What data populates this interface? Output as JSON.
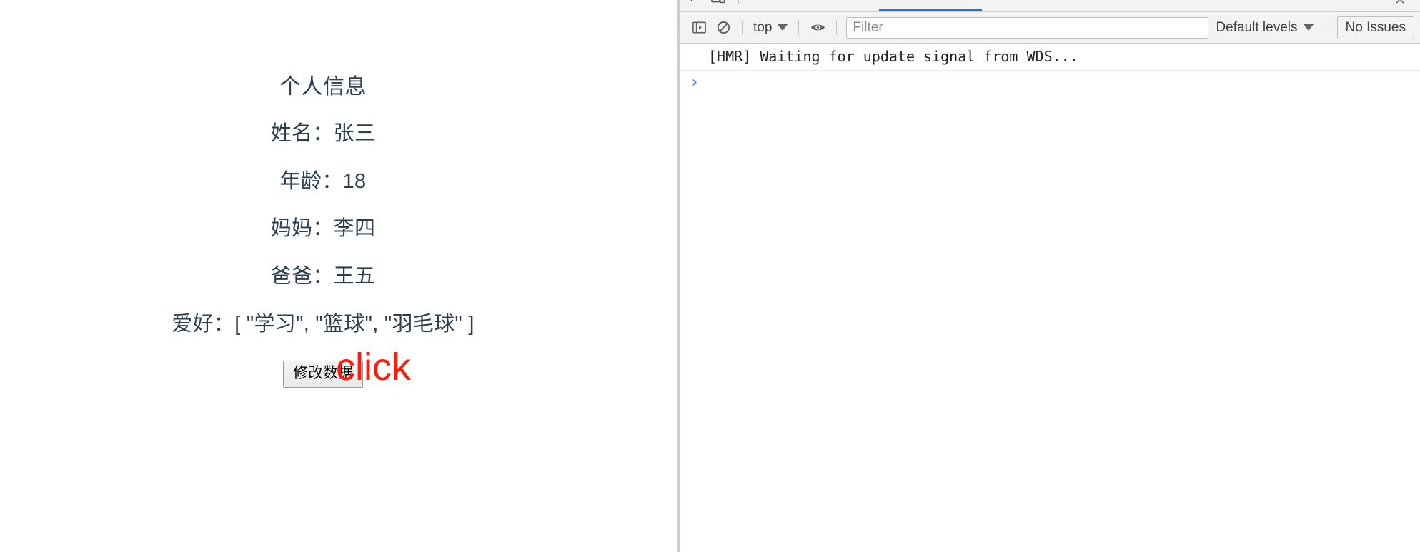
{
  "page": {
    "title": "个人信息",
    "fields": [
      {
        "label": "姓名：",
        "value": "张三"
      },
      {
        "label": "年龄：",
        "value": "18"
      },
      {
        "label": "妈妈：",
        "value": "李四"
      },
      {
        "label": "爸爸：",
        "value": "王五"
      },
      {
        "label": "爱好：",
        "value": "[ \"学习\", \"篮球\", \"羽毛球\" ]"
      }
    ],
    "button_label": "修改数据",
    "annotation": "click",
    "annotation_color": "#ff1a09",
    "text_color": "#2c3e50"
  },
  "devtools": {
    "main_toolbar": {
      "inspect_icon": "inspect-element-icon",
      "device_icon": "device-toolbar-icon",
      "close_icon": "close-icon"
    },
    "console_toolbar": {
      "sidebar_toggle_icon": "console-sidebar-toggle-icon",
      "clear_icon": "clear-console-icon",
      "context_label": "top",
      "context_caret_icon": "chevron-down-icon",
      "eye_icon": "live-expression-eye-icon",
      "filter_placeholder": "Filter",
      "filter_value": "",
      "levels_label": "Default levels",
      "levels_caret_icon": "chevron-down-icon",
      "issues_label": "No Issues",
      "active_tab_accent": "#1a73e8"
    },
    "console": {
      "messages": [
        {
          "text": "[HMR] Waiting for update signal from WDS..."
        }
      ],
      "prompt_chevron": "›",
      "prompt_value": ""
    }
  }
}
